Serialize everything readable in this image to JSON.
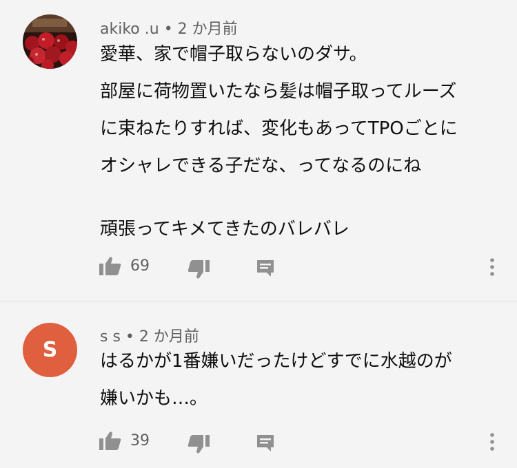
{
  "comments": [
    {
      "author": "akiko .u",
      "separator": "•",
      "time": "2 か月前",
      "lines": [
        "愛華、家で帽子取らないのダサ。",
        "部屋に荷物置いたなら髪は帽子取ってルーズ",
        "に束ねたりすれば、変化もあってTPOごとに",
        "オシャレできる子だな、ってなるのにね",
        "頑張ってキメてきたのバレバレ"
      ],
      "likes": "69"
    },
    {
      "author": "s s",
      "separator": "•",
      "time": "2 か月前",
      "avatar_initial": "S",
      "avatar_color": "#e05f3e",
      "lines": [
        "はるかが1番嫌いだったけどすでに水越のが",
        "嫌いかも…。"
      ],
      "likes": "39"
    }
  ],
  "icons": [
    "like-icon",
    "dislike-icon",
    "reply-icon",
    "more-vert-icon"
  ]
}
